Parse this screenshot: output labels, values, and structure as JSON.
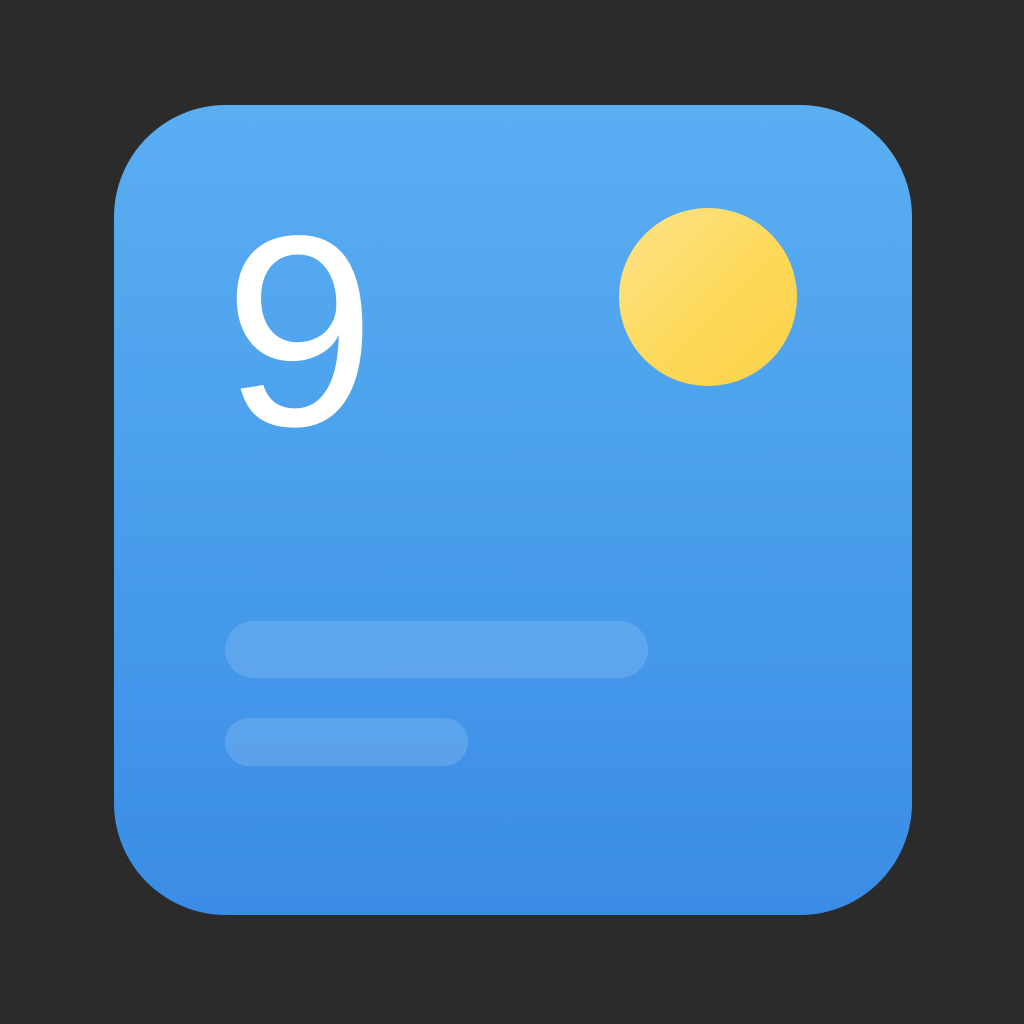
{
  "icon": {
    "day_number": "9",
    "background_color": "#4ba0ec",
    "sun_color": "#fdd855",
    "text_line_color": "#ffffff"
  }
}
